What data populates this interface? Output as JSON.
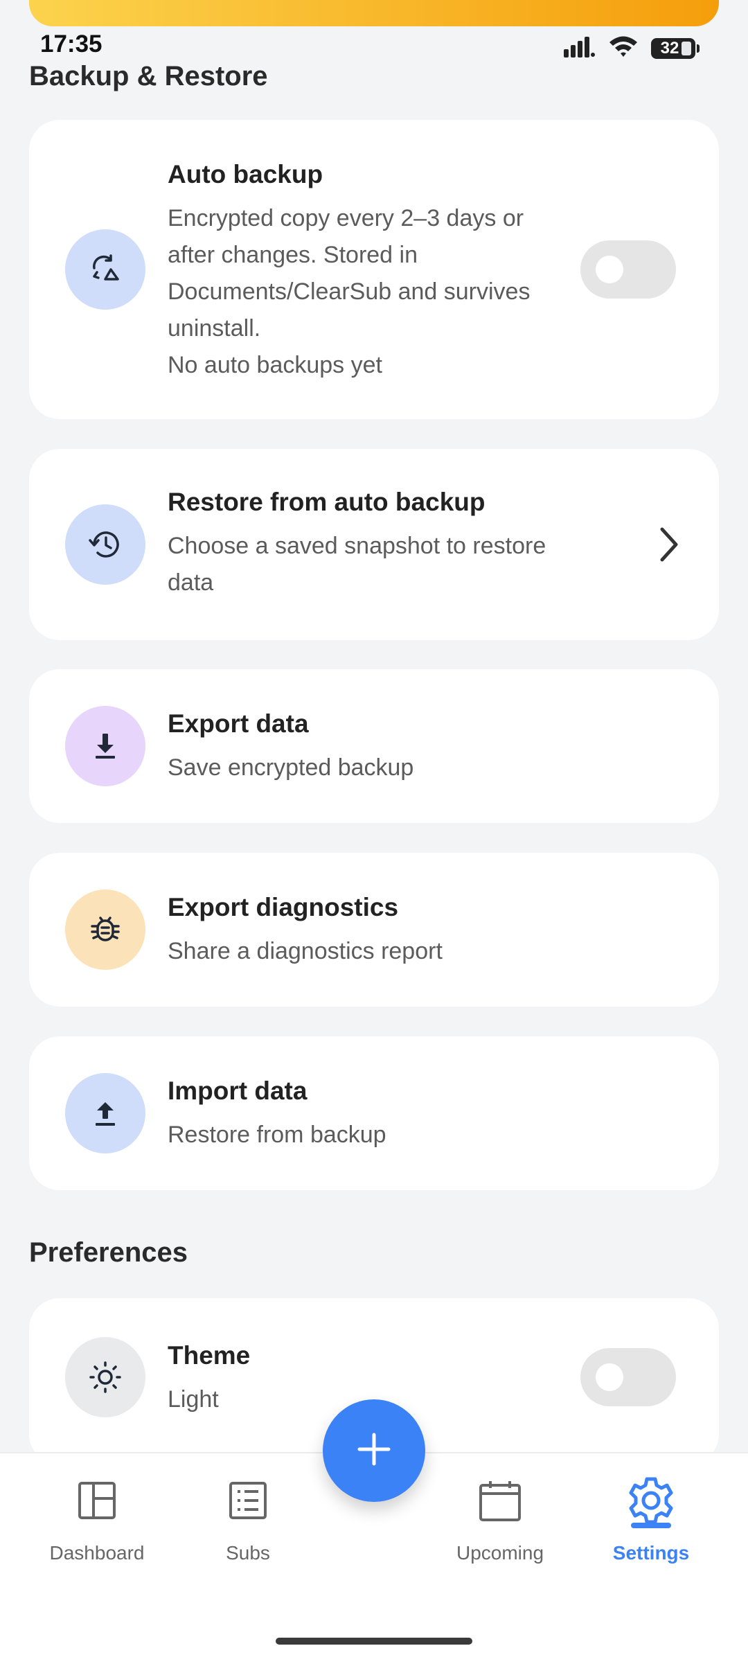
{
  "status_bar": {
    "time": "17:35",
    "battery": "32",
    "icons": [
      "signal-icon",
      "wifi-icon",
      "battery-icon"
    ]
  },
  "backup_section": {
    "title": "Backup & Restore",
    "auto_backup": {
      "title": "Auto backup",
      "description_lines": [
        "Encrypted copy every 2–3 days or",
        "after changes. Stored in",
        "Documents/ClearSub and survives",
        "uninstall."
      ],
      "status": "No auto backups yet",
      "toggle_on": false
    },
    "restore": {
      "title": "Restore from auto backup",
      "description_lines": [
        "Choose a saved snapshot to restore",
        "data"
      ]
    },
    "export_data": {
      "title": "Export data",
      "subtitle": "Save encrypted backup"
    },
    "export_diagnostics": {
      "title": "Export diagnostics",
      "subtitle": "Share a diagnostics report"
    },
    "import_data": {
      "title": "Import data",
      "subtitle": "Restore from backup"
    }
  },
  "preferences_section": {
    "title": "Preferences",
    "theme": {
      "title": "Theme",
      "value": "Light",
      "toggle_on": false
    }
  },
  "bottom_nav": {
    "items": [
      {
        "label": "Dashboard",
        "icon": "dashboard-icon",
        "active": false
      },
      {
        "label": "Subs",
        "icon": "list-icon",
        "active": false
      },
      {
        "label": "Upcoming",
        "icon": "calendar-icon",
        "active": false
      },
      {
        "label": "Settings",
        "icon": "gear-icon",
        "active": true
      }
    ],
    "fab_icon": "plus-icon"
  },
  "colors": {
    "accent": "#3B82F6",
    "background": "#F3F4F6",
    "icon_blue_bg": "#CFDDFB",
    "icon_purple_bg": "#E7D5FB",
    "icon_orange_bg": "#FCE2B8",
    "icon_gray_bg": "#E9EAEC"
  }
}
